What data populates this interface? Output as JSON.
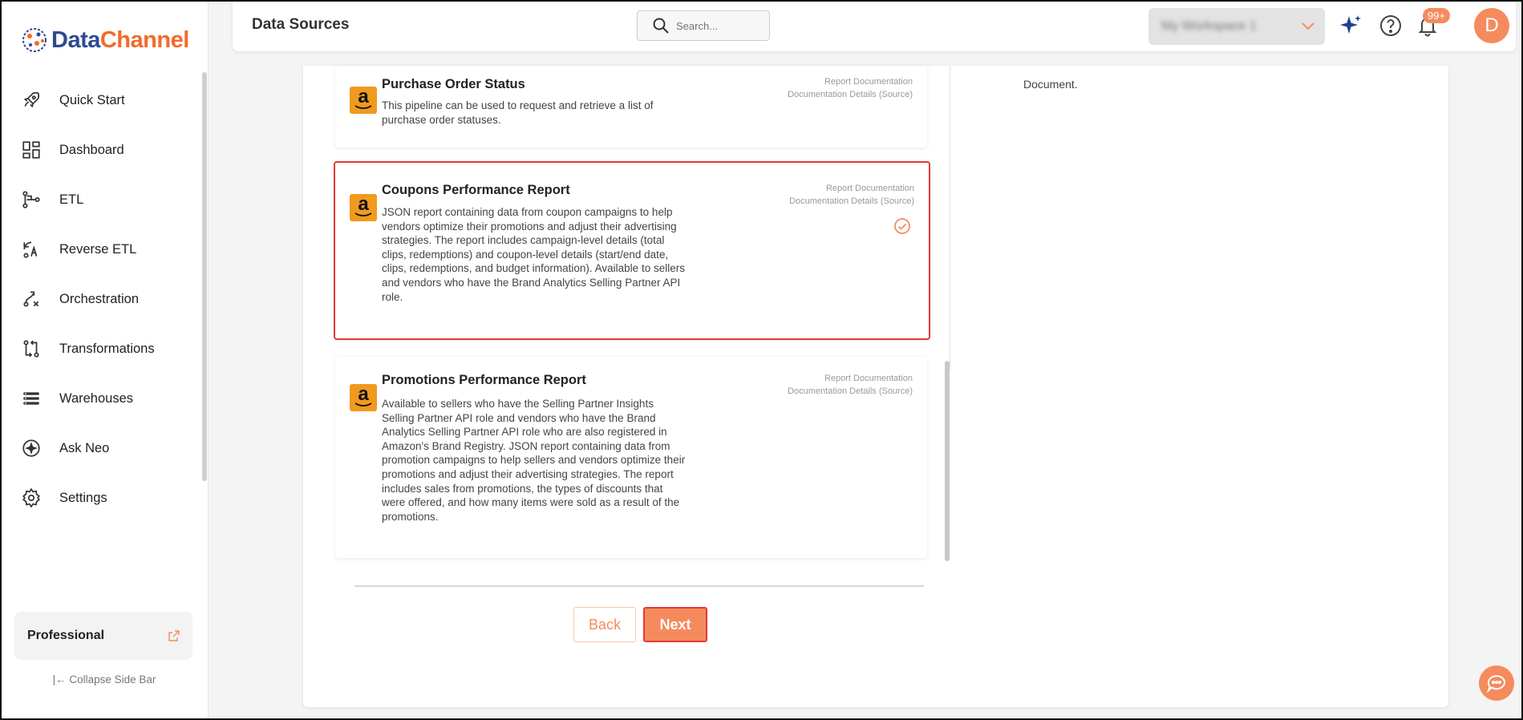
{
  "brand": {
    "part1": "Data",
    "part2": "Channel"
  },
  "sidebar": {
    "items": [
      {
        "label": "Quick Start",
        "icon": "rocket-icon"
      },
      {
        "label": "Dashboard",
        "icon": "dashboard-icon"
      },
      {
        "label": "ETL",
        "icon": "etl-icon"
      },
      {
        "label": "Reverse ETL",
        "icon": "reverse-etl-icon"
      },
      {
        "label": "Orchestration",
        "icon": "orchestration-icon"
      },
      {
        "label": "Transformations",
        "icon": "transformations-icon"
      },
      {
        "label": "Warehouses",
        "icon": "warehouses-icon"
      },
      {
        "label": "Ask Neo",
        "icon": "ask-neo-icon"
      },
      {
        "label": "Settings",
        "icon": "gear-icon"
      }
    ],
    "plan": "Professional",
    "collapse_label": "Collapse Side Bar"
  },
  "header": {
    "title": "Data Sources",
    "search_placeholder": "Search...",
    "workspace": "My Workspace 1",
    "notification_count": "99+",
    "avatar_initial": "D"
  },
  "right_panel": {
    "text": "Document."
  },
  "cards": [
    {
      "title": "Purchase Order Status",
      "description": "This pipeline can be used to request and retrieve a list of purchase order statuses.",
      "doc_link_1": "Report Documentation",
      "doc_link_2": "Documentation Details (Source)",
      "selected": false
    },
    {
      "title": "Coupons Performance Report",
      "description": "JSON report containing data from coupon campaigns to help vendors optimize their promotions and adjust their advertising strategies. The report includes campaign-level details (total clips, redemptions) and coupon-level details (start/end date, clips, redemptions, and budget information). Available to sellers and vendors who have the Brand Analytics Selling Partner API role.",
      "doc_link_1": "Report Documentation",
      "doc_link_2": "Documentation Details (Source)",
      "selected": true
    },
    {
      "title": "Promotions Performance Report",
      "description": "Available to sellers who have the Selling Partner Insights Selling Partner API role and vendors who have the Brand Analytics Selling Partner API role who are also registered in Amazon's Brand Registry. JSON report containing data from promotion campaigns to help sellers and vendors optimize their promotions and adjust their advertising strategies. The report includes sales from promotions, the types of discounts that were offered, and how many items were sold as a result of the promotions.",
      "doc_link_1": "Report Documentation",
      "doc_link_2": "Documentation Details (Source)",
      "selected": false
    }
  ],
  "buttons": {
    "back": "Back",
    "next": "Next"
  },
  "colors": {
    "accent": "#f58b5d",
    "brand_blue": "#2d4a93",
    "brand_orange": "#f26b2a",
    "selected_border": "#e53935",
    "amazon_orange": "#f09a1e"
  }
}
